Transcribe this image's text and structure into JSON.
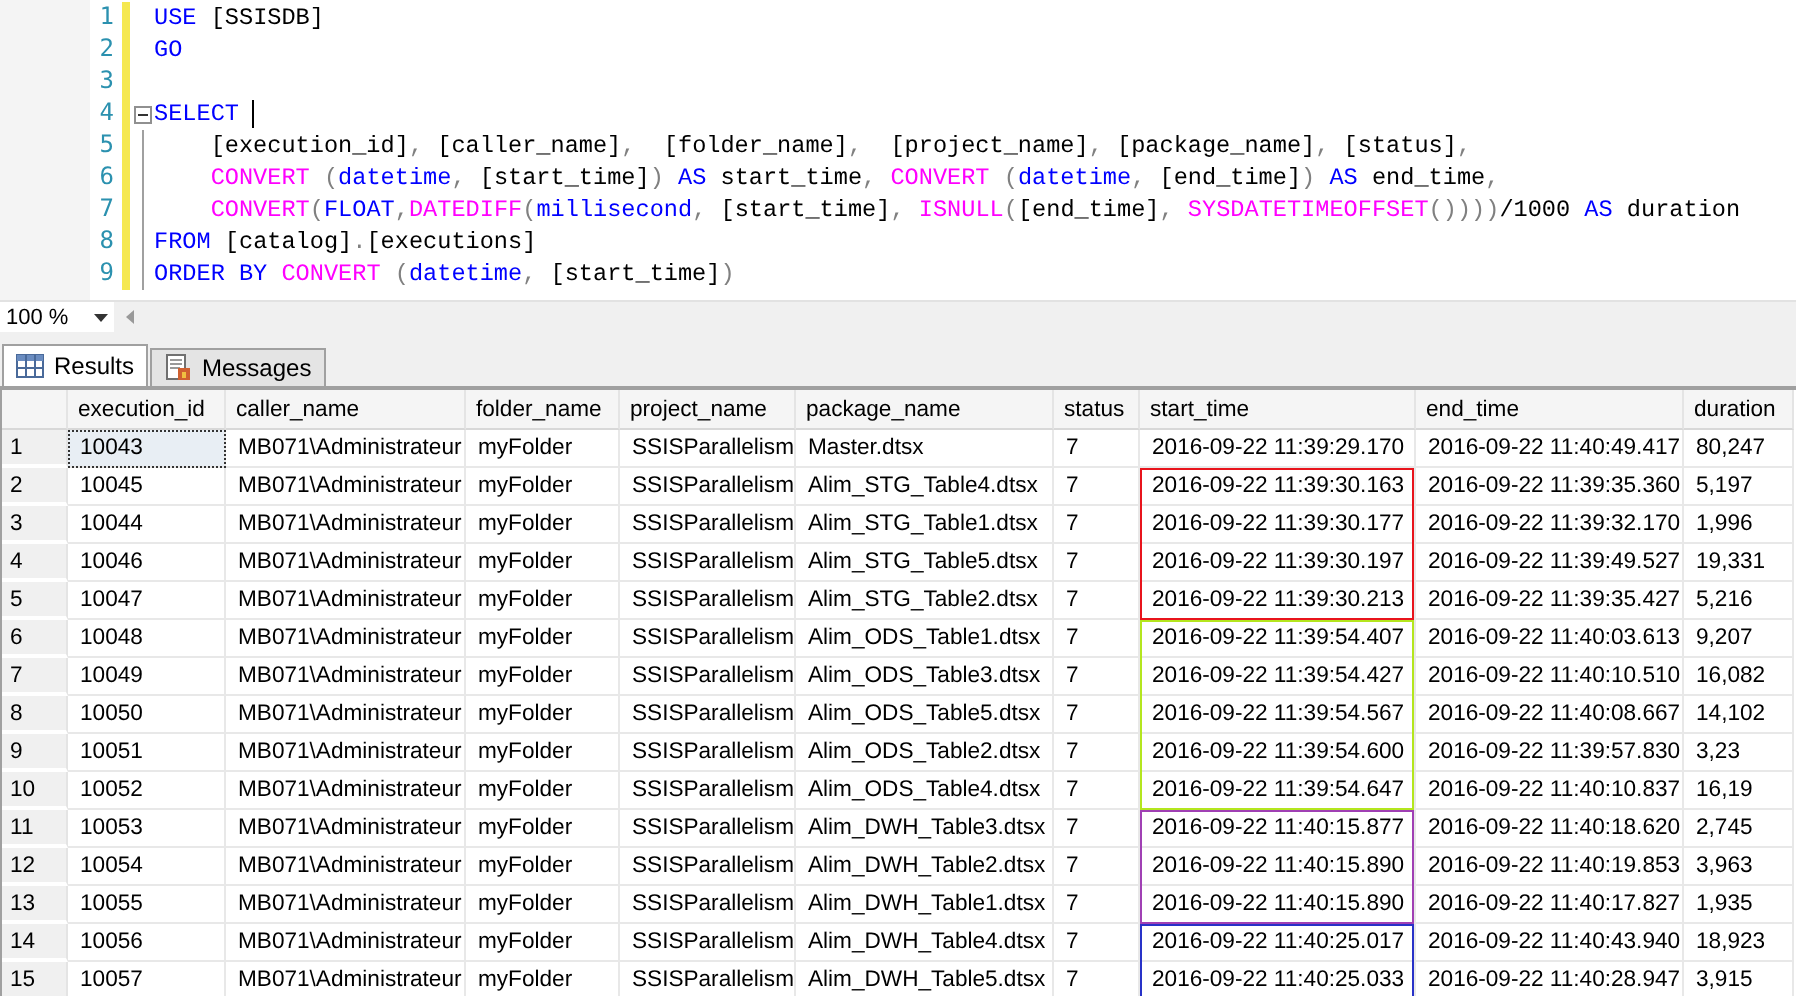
{
  "editor": {
    "lines": [
      {
        "number": "1",
        "tokens": [
          {
            "kind": "kw",
            "text": "USE"
          },
          {
            "kind": "plain",
            "text": " [SSISDB]"
          }
        ]
      },
      {
        "number": "2",
        "tokens": [
          {
            "kind": "kw",
            "text": "GO"
          }
        ]
      },
      {
        "number": "3"
      },
      {
        "number": "4",
        "fold": true,
        "cursor": true,
        "tokens": [
          {
            "kind": "kw",
            "text": "SELECT"
          }
        ]
      },
      {
        "number": "5",
        "indent": true,
        "tokens": [
          {
            "kind": "plain",
            "text": "[execution_id]"
          },
          {
            "kind": "punct",
            "text": ","
          },
          {
            "kind": "plain",
            "text": " [caller_name]"
          },
          {
            "kind": "punct",
            "text": ","
          },
          {
            "kind": "plain",
            "text": "  [folder_name]"
          },
          {
            "kind": "punct",
            "text": ","
          },
          {
            "kind": "plain",
            "text": "  [project_name]"
          },
          {
            "kind": "punct",
            "text": ","
          },
          {
            "kind": "plain",
            "text": " [package_name]"
          },
          {
            "kind": "punct",
            "text": ","
          },
          {
            "kind": "plain",
            "text": " [status]"
          },
          {
            "kind": "punct",
            "text": ","
          }
        ]
      },
      {
        "number": "6",
        "indent": true,
        "tokens": [
          {
            "kind": "fn",
            "text": "CONVERT"
          },
          {
            "kind": "punct",
            "text": " ("
          },
          {
            "kind": "kw",
            "text": "datetime"
          },
          {
            "kind": "punct",
            "text": ","
          },
          {
            "kind": "plain",
            "text": " [start_time]"
          },
          {
            "kind": "punct",
            "text": ")"
          },
          {
            "kind": "kw",
            "text": " AS"
          },
          {
            "kind": "plain",
            "text": " start_time"
          },
          {
            "kind": "punct",
            "text": ","
          },
          {
            "kind": "fn",
            "text": " CONVERT"
          },
          {
            "kind": "punct",
            "text": " ("
          },
          {
            "kind": "kw",
            "text": "datetime"
          },
          {
            "kind": "punct",
            "text": ","
          },
          {
            "kind": "plain",
            "text": " [end_time]"
          },
          {
            "kind": "punct",
            "text": ")"
          },
          {
            "kind": "kw",
            "text": " AS"
          },
          {
            "kind": "plain",
            "text": " end_time"
          },
          {
            "kind": "punct",
            "text": ","
          }
        ]
      },
      {
        "number": "7",
        "indent": true,
        "tokens": [
          {
            "kind": "fn",
            "text": "CONVERT"
          },
          {
            "kind": "punct",
            "text": "("
          },
          {
            "kind": "kw",
            "text": "FLOAT"
          },
          {
            "kind": "punct",
            "text": ","
          },
          {
            "kind": "fn",
            "text": "DATEDIFF"
          },
          {
            "kind": "punct",
            "text": "("
          },
          {
            "kind": "kw",
            "text": "millisecond"
          },
          {
            "kind": "punct",
            "text": ","
          },
          {
            "kind": "plain",
            "text": " [start_time]"
          },
          {
            "kind": "punct",
            "text": ","
          },
          {
            "kind": "fn",
            "text": " ISNULL"
          },
          {
            "kind": "punct",
            "text": "("
          },
          {
            "kind": "plain",
            "text": "[end_time]"
          },
          {
            "kind": "punct",
            "text": ","
          },
          {
            "kind": "fn",
            "text": " SYSDATETIMEOFFSET"
          },
          {
            "kind": "punct",
            "text": "())))"
          },
          {
            "kind": "plain",
            "text": "/1000"
          },
          {
            "kind": "kw",
            "text": " AS"
          },
          {
            "kind": "plain",
            "text": " duration"
          }
        ]
      },
      {
        "number": "8",
        "tokens": [
          {
            "kind": "kw",
            "text": "FROM"
          },
          {
            "kind": "plain",
            "text": " [catalog]"
          },
          {
            "kind": "punct",
            "text": "."
          },
          {
            "kind": "plain",
            "text": "[executions]"
          }
        ]
      },
      {
        "number": "9",
        "tokens": [
          {
            "kind": "kw",
            "text": "ORDER BY"
          },
          {
            "kind": "fn",
            "text": " CONVERT"
          },
          {
            "kind": "punct",
            "text": " ("
          },
          {
            "kind": "kw",
            "text": "datetime"
          },
          {
            "kind": "punct",
            "text": ","
          },
          {
            "kind": "plain",
            "text": " [start_time]"
          },
          {
            "kind": "punct",
            "text": ")"
          }
        ]
      }
    ]
  },
  "zoom": {
    "value": "100 %"
  },
  "tabs": [
    {
      "label": "Results",
      "kind": "grid",
      "selected": true
    },
    {
      "label": "Messages",
      "kind": "messages",
      "selected": false
    }
  ],
  "table": {
    "columns": [
      "execution_id",
      "caller_name",
      "folder_name",
      "project_name",
      "package_name",
      "status",
      "start_time",
      "end_time",
      "duration"
    ],
    "rows": [
      {
        "number": "1",
        "focused": true,
        "cells": [
          "10043",
          "MB071\\Administrateur",
          "myFolder",
          "SSISParallelism",
          "Master.dtsx",
          "7",
          "2016-09-22 11:39:29.170",
          "2016-09-22 11:40:49.417",
          "80,247"
        ]
      },
      {
        "number": "2",
        "focused": false,
        "color": "#e8141c",
        "cells": [
          "10045",
          "MB071\\Administrateur",
          "myFolder",
          "SSISParallelism",
          "Alim_STG_Table4.dtsx",
          "7",
          "2016-09-22 11:39:30.163",
          "2016-09-22 11:39:35.360",
          "5,197"
        ]
      },
      {
        "number": "3",
        "focused": false,
        "color": "#e8141c",
        "cells": [
          "10044",
          "MB071\\Administrateur",
          "myFolder",
          "SSISParallelism",
          "Alim_STG_Table1.dtsx",
          "7",
          "2016-09-22 11:39:30.177",
          "2016-09-22 11:39:32.170",
          "1,996"
        ]
      },
      {
        "number": "4",
        "focused": false,
        "color": "#e8141c",
        "cells": [
          "10046",
          "MB071\\Administrateur",
          "myFolder",
          "SSISParallelism",
          "Alim_STG_Table5.dtsx",
          "7",
          "2016-09-22 11:39:30.197",
          "2016-09-22 11:39:49.527",
          "19,331"
        ]
      },
      {
        "number": "5",
        "focused": false,
        "color": "#e8141c",
        "cells": [
          "10047",
          "MB071\\Administrateur",
          "myFolder",
          "SSISParallelism",
          "Alim_STG_Table2.dtsx",
          "7",
          "2016-09-22 11:39:30.213",
          "2016-09-22 11:39:35.427",
          "5,216"
        ]
      },
      {
        "number": "6",
        "focused": false,
        "color": "#b4e61e",
        "cells": [
          "10048",
          "MB071\\Administrateur",
          "myFolder",
          "SSISParallelism",
          "Alim_ODS_Table1.dtsx",
          "7",
          "2016-09-22 11:39:54.407",
          "2016-09-22 11:40:03.613",
          "9,207"
        ]
      },
      {
        "number": "7",
        "focused": false,
        "color": "#b4e61e",
        "cells": [
          "10049",
          "MB071\\Administrateur",
          "myFolder",
          "SSISParallelism",
          "Alim_ODS_Table3.dtsx",
          "7",
          "2016-09-22 11:39:54.427",
          "2016-09-22 11:40:10.510",
          "16,082"
        ]
      },
      {
        "number": "8",
        "focused": false,
        "color": "#b4e61e",
        "cells": [
          "10050",
          "MB071\\Administrateur",
          "myFolder",
          "SSISParallelism",
          "Alim_ODS_Table5.dtsx",
          "7",
          "2016-09-22 11:39:54.567",
          "2016-09-22 11:40:08.667",
          "14,102"
        ]
      },
      {
        "number": "9",
        "focused": false,
        "color": "#b4e61e",
        "cells": [
          "10051",
          "MB071\\Administrateur",
          "myFolder",
          "SSISParallelism",
          "Alim_ODS_Table2.dtsx",
          "7",
          "2016-09-22 11:39:54.600",
          "2016-09-22 11:39:57.830",
          "3,23"
        ]
      },
      {
        "number": "10",
        "focused": false,
        "color": "#b4e61e",
        "cells": [
          "10052",
          "MB071\\Administrateur",
          "myFolder",
          "SSISParallelism",
          "Alim_ODS_Table4.dtsx",
          "7",
          "2016-09-22 11:39:54.647",
          "2016-09-22 11:40:10.837",
          "16,19"
        ]
      },
      {
        "number": "11",
        "focused": false,
        "color": "#a040b4",
        "cells": [
          "10053",
          "MB071\\Administrateur",
          "myFolder",
          "SSISParallelism",
          "Alim_DWH_Table3.dtsx",
          "7",
          "2016-09-22 11:40:15.877",
          "2016-09-22 11:40:18.620",
          "2,745"
        ]
      },
      {
        "number": "12",
        "focused": false,
        "color": "#a040b4",
        "cells": [
          "10054",
          "MB071\\Administrateur",
          "myFolder",
          "SSISParallelism",
          "Alim_DWH_Table2.dtsx",
          "7",
          "2016-09-22 11:40:15.890",
          "2016-09-22 11:40:19.853",
          "3,963"
        ]
      },
      {
        "number": "13",
        "focused": false,
        "color": "#a040b4",
        "cells": [
          "10055",
          "MB071\\Administrateur",
          "myFolder",
          "SSISParallelism",
          "Alim_DWH_Table1.dtsx",
          "7",
          "2016-09-22 11:40:15.890",
          "2016-09-22 11:40:17.827",
          "1,935"
        ]
      },
      {
        "number": "14",
        "focused": false,
        "color": "#2832c8",
        "cells": [
          "10056",
          "MB071\\Administrateur",
          "myFolder",
          "SSISParallelism",
          "Alim_DWH_Table4.dtsx",
          "7",
          "2016-09-22 11:40:25.017",
          "2016-09-22 11:40:43.940",
          "18,923"
        ]
      },
      {
        "number": "15",
        "focused": false,
        "color": "#2832c8",
        "cells": [
          "10057",
          "MB071\\Administrateur",
          "myFolder",
          "SSISParallelism",
          "Alim_DWH_Table5.dtsx",
          "7",
          "2016-09-22 11:40:25.033",
          "2016-09-22 11:40:28.947",
          "3,915"
        ]
      }
    ]
  }
}
